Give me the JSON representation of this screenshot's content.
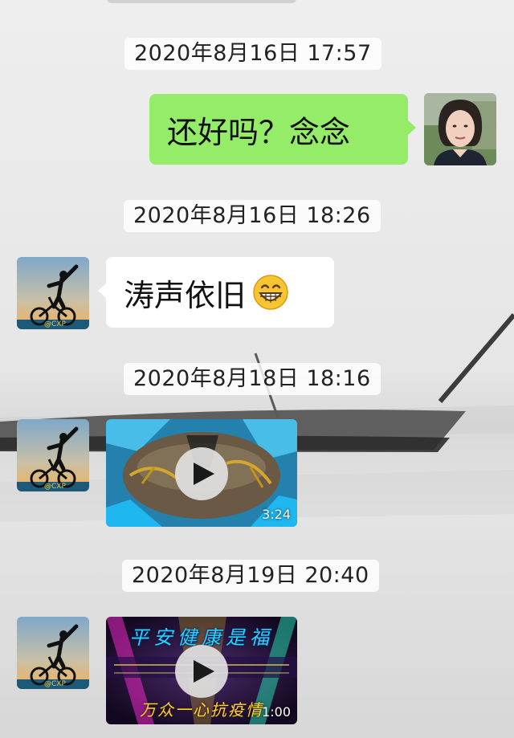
{
  "messages": [
    {
      "timestamp": "2020年8月16日 17:57",
      "sender": "me",
      "text": "还好吗？念念"
    },
    {
      "timestamp": "2020年8月16日 18:26",
      "sender": "contact",
      "text": "涛声依旧",
      "emoji": "grinning-face"
    },
    {
      "timestamp": "2020年8月18日 18:16",
      "sender": "contact",
      "type": "video",
      "duration": "3:24",
      "thumbnail": "blue-frame-calligraphy"
    },
    {
      "timestamp": "2020年8月19日 20:40",
      "sender": "contact",
      "type": "video",
      "duration": "1:00",
      "thumbnail_text": [
        "平安健康是福",
        "万众一心抗疫情"
      ]
    }
  ],
  "icons": {
    "play": "play-icon"
  },
  "colors": {
    "outgoing_bubble": "#95ec69",
    "incoming_bubble": "#ffffff"
  }
}
